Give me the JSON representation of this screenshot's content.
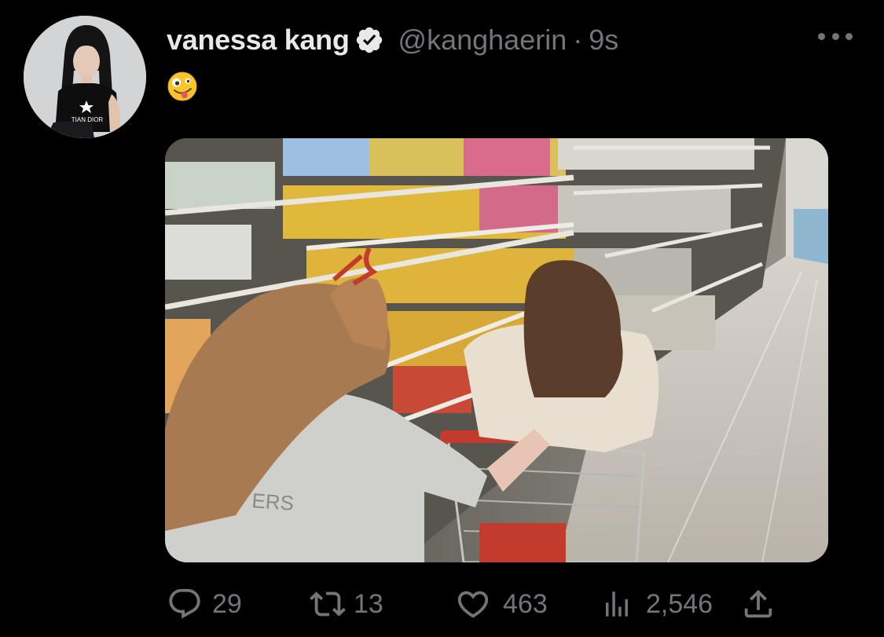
{
  "tweet": {
    "author_name": "vanessa kang",
    "author_handle": "@kanghaerin",
    "separator": "·",
    "timestamp": "9s",
    "avatar_shirt_text": "TIAN DIOR",
    "media_shirt_text": "ERS",
    "verified": true,
    "body_emoji": "zany-face-emoji"
  },
  "actions": {
    "replies": "29",
    "retweets": "13",
    "likes": "463",
    "views": "2,546"
  },
  "icons": [
    "verified-icon",
    "more-icon",
    "reply-icon",
    "retweet-icon",
    "like-icon",
    "views-icon",
    "share-icon"
  ],
  "colors": {
    "background": "#000000",
    "text_primary": "#e7e9ea",
    "text_secondary": "#71767b"
  }
}
